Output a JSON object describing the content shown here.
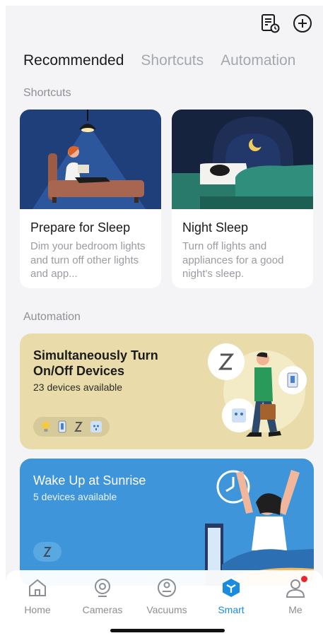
{
  "tabs": [
    "Recommended",
    "Shortcuts",
    "Automation"
  ],
  "sections": {
    "shortcuts": "Shortcuts",
    "automation": "Automation"
  },
  "shortcuts": [
    {
      "title": "Prepare for Sleep",
      "desc": "Dim your bedroom lights and turn off other lights and app..."
    },
    {
      "title": "Night Sleep",
      "desc": "Turn off lights and appliances for a good night's sleep."
    }
  ],
  "automations": [
    {
      "title_line1": "Simultaneously Turn",
      "title_line2": "On/Off Devices",
      "subtitle": "23 devices available",
      "bg": "#e9dcaa"
    },
    {
      "title_line1": "Wake Up at Sunrise",
      "subtitle": "5 devices available",
      "bg": "#3e95d9"
    }
  ],
  "nav": [
    {
      "label": "Home",
      "icon": "home-icon"
    },
    {
      "label": "Cameras",
      "icon": "camera-icon"
    },
    {
      "label": "Vacuums",
      "icon": "vacuum-icon"
    },
    {
      "label": "Smart",
      "icon": "smart-cube-icon"
    },
    {
      "label": "Me",
      "icon": "profile-icon"
    }
  ],
  "colors": {
    "accent": "#1a8cdf",
    "badge": "#e8262e"
  }
}
